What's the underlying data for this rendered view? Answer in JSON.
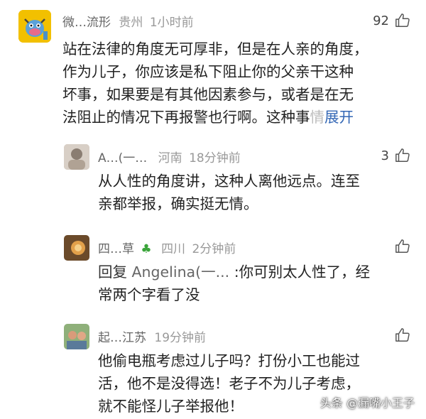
{
  "comments": [
    {
      "name": "微…流形",
      "location": "贵州",
      "time": "1小时前",
      "likes": "92",
      "text_line1": "站在法律的角度无可厚非，但是在人亲的角度，",
      "text_line2": "作为儿子，你应该是私下阻止你的父亲干这种",
      "text_line3": "坏事，如果要是有其他因素参与，或者是在无",
      "text_line4": "法阻止的情况下再报警也行啊。这种事",
      "text_fade": "情",
      "expand": "展开"
    },
    {
      "name": "A…(一…",
      "location": "河南",
      "time": "18分钟前",
      "likes": "3",
      "text_line1": "从人性的角度讲，这种人离他远点。连至",
      "text_line2": "亲都举报，确实挺无情。"
    },
    {
      "name": "四…草",
      "location": "四川",
      "time": "2分钟前",
      "likes": "",
      "reply_prefix": "回复 ",
      "reply_target": "Angelina(一...",
      "text_line1": " :你可别太人性了，经",
      "text_line2": "常两个字看了没"
    },
    {
      "name": "起…江苏",
      "location": "江苏",
      "time": "19分钟前",
      "likes": "",
      "text_line1": "他偷电瓶考虑过儿子吗？打份小工也能过",
      "text_line2": "活，他不是没得选！老子不为儿子考虑，",
      "text_line3": "就不能怪儿子举报他！"
    }
  ],
  "watermark": "头条 @漏嘴小王子",
  "colors": {
    "expand_link": "#3367b5",
    "meta": "#999999",
    "avatar_main_bg": "#f2c000"
  }
}
